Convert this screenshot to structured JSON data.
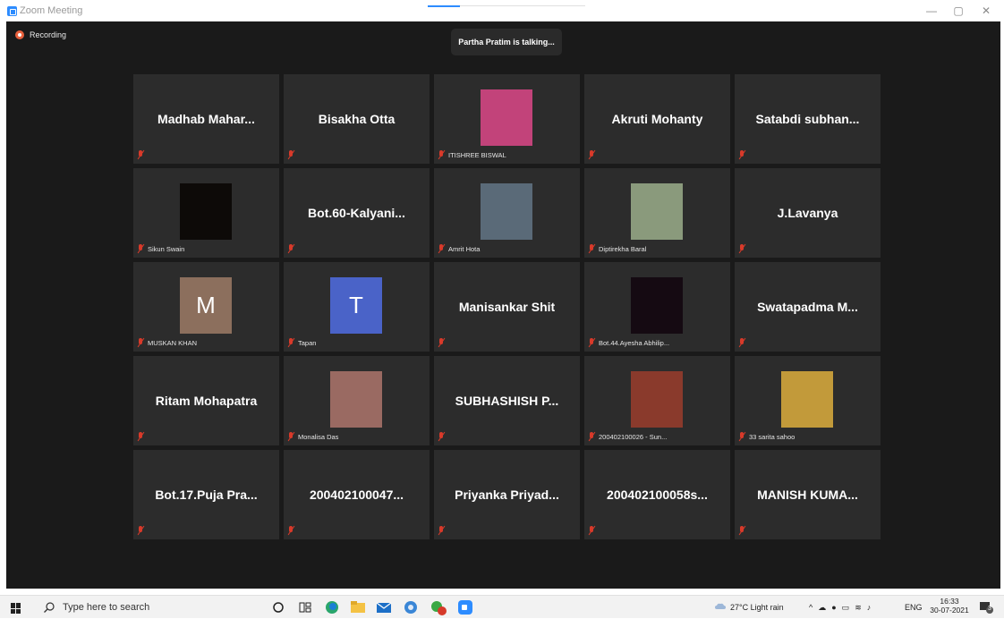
{
  "window": {
    "title": "Zoom Meeting",
    "controls": {
      "minimize": "—",
      "restore": "▢",
      "close": "✕"
    }
  },
  "meeting": {
    "recording_label": "Recording",
    "talking_banner": "Partha Pratim is talking...",
    "tiles": [
      {
        "type": "name",
        "big": "Madhab  Mahar...",
        "caption": ""
      },
      {
        "type": "name",
        "big": "Bisakha Otta",
        "caption": ""
      },
      {
        "type": "photo",
        "caption": "ITISHREE BISWAL",
        "color": "#c2437a"
      },
      {
        "type": "name",
        "big": "Akruti Mohanty",
        "caption": ""
      },
      {
        "type": "name",
        "big": "Satabdi  subhan...",
        "caption": ""
      },
      {
        "type": "photo",
        "caption": "Sikun Swain",
        "color": "#0d0a08"
      },
      {
        "type": "name",
        "big": "Bot.60-Kalyani...",
        "caption": ""
      },
      {
        "type": "photo",
        "caption": "Amrit Hota",
        "color": "#5a6a78"
      },
      {
        "type": "photo",
        "caption": "Diptirekha Baral",
        "color": "#8a9a7c"
      },
      {
        "type": "name",
        "big": "J.Lavanya",
        "caption": ""
      },
      {
        "type": "letter",
        "letter": "M",
        "caption": "MUSKAN KHAN",
        "color": "#8c6f5d"
      },
      {
        "type": "letter",
        "letter": "T",
        "caption": "Tapan",
        "color": "#4a63c8"
      },
      {
        "type": "name",
        "big": "Manisankar Shit",
        "caption": ""
      },
      {
        "type": "photo",
        "caption": "Bot.44.Ayesha Abhilip...",
        "color": "#150a12"
      },
      {
        "type": "name",
        "big": "Swatapadma  M...",
        "caption": ""
      },
      {
        "type": "name",
        "big": "Ritam Mohapatra",
        "caption": ""
      },
      {
        "type": "photo",
        "caption": "Monalisa Das",
        "color": "#9a6a62"
      },
      {
        "type": "name",
        "big": "SUBHASHISH  P...",
        "caption": ""
      },
      {
        "type": "photo",
        "caption": "200402100026 - Sun...",
        "color": "#8a3a2c"
      },
      {
        "type": "photo",
        "caption": "33 sarita sahoo",
        "color": "#c29a3a"
      },
      {
        "type": "name",
        "big": "Bot.17.Puja  Pra...",
        "caption": ""
      },
      {
        "type": "name",
        "big": "200402100047...",
        "caption": ""
      },
      {
        "type": "name",
        "big": "Priyanka  Priyad...",
        "caption": ""
      },
      {
        "type": "name",
        "big": "200402100058s...",
        "caption": ""
      },
      {
        "type": "name",
        "big": "MANISH  KUMA...",
        "caption": ""
      }
    ]
  },
  "taskbar": {
    "search_placeholder": "Type here to search",
    "weather": "27°C  Light rain",
    "language": "ENG",
    "time": "16:33",
    "date": "30-07-2021",
    "notification_count": "3",
    "pinned_icons": [
      "cortana-circle-icon",
      "task-view-icon",
      "edge-icon",
      "file-explorer-icon",
      "mail-icon",
      "chrome-icon",
      "app-badge-icon",
      "zoom-icon"
    ]
  },
  "colors": {
    "meeting_bg": "#1a1a1a",
    "tile_bg": "#2c2c2c",
    "mute_red": "#d83a2a",
    "zoom_blue": "#2D8CFF",
    "recording": "#e8603c"
  }
}
